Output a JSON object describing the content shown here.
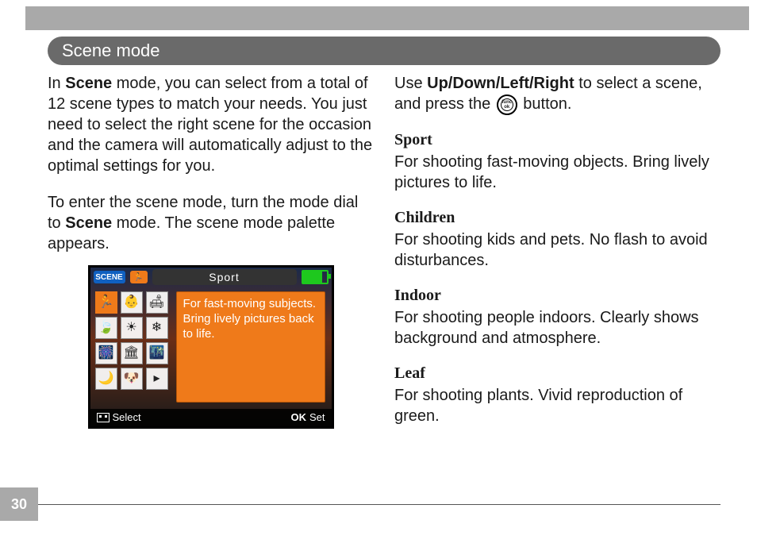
{
  "page_number": "30",
  "section_title": "Scene mode",
  "left": {
    "p1_a": "In ",
    "p1_b": "Scene",
    "p1_c": " mode, you can select from a total of 12 scene types to match your needs. You just need to select the right scene for the occasion and the camera will automatically adjust to the optimal settings for you.",
    "p2_a": "To enter the scene mode, turn the mode dial to ",
    "p2_b": "Scene",
    "p2_c": " mode. The scene mode palette appears."
  },
  "right": {
    "p1_a": "Use ",
    "p1_b": "Up/Down/Left/Right",
    "p1_c": " to select a scene, and press the ",
    "p1_d": " button.",
    "func_label": "func\nok"
  },
  "scenes": [
    {
      "name": "Sport",
      "desc": "For shooting fast-moving objects.  Bring lively pictures to life."
    },
    {
      "name": "Children",
      "desc": "For shooting kids and pets.  No flash to avoid disturbances."
    },
    {
      "name": "Indoor",
      "desc": "For shooting people indoors.  Clearly shows background and atmosphere."
    },
    {
      "name": "Leaf",
      "desc": "For shooting plants.  Vivid reproduction of green."
    }
  ],
  "lcd": {
    "badge_scene": "SCENE",
    "runner_glyph": "🏃",
    "title": "Sport",
    "desc": "For fast-moving subjects. Bring lively pictures back to life.",
    "select_label": "Select",
    "set_label": "Set",
    "ok_label": "OK",
    "icons": [
      "🏃",
      "👶",
      "🛋",
      "🍃",
      "☀",
      "❄",
      "🎆",
      "🏛",
      "🌃",
      "🌙",
      "🐶",
      "▸"
    ]
  }
}
